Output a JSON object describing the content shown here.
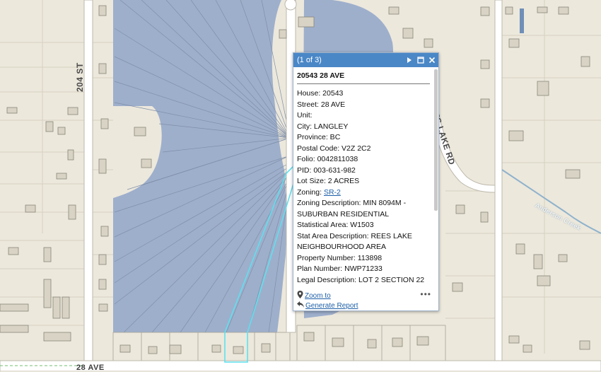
{
  "map": {
    "road_labels": {
      "st204": "204 ST",
      "rees_lake_rd": "REES LAKE RD",
      "anderson_creek": "Anderson Creek",
      "ave28": "28 AVE"
    }
  },
  "popup": {
    "counter": "(1 of 3)",
    "heading": "20543 28 AVE",
    "fields": {
      "house": "House: 20543",
      "street": "Street: 28 AVE",
      "unit": "Unit:",
      "city": "City: LANGLEY",
      "province": "Province: BC",
      "postal_code": "Postal Code: V2Z 2C2",
      "folio": "Folio: 0042811038",
      "pid": "PID: 003-631-982",
      "lot_size": "Lot Size: 2 ACRES",
      "zoning_label": "Zoning: ",
      "zoning_link": "SR-2",
      "zoning_description": "Zoning Description: MIN 8094M - SUBURBAN RESIDENTIAL",
      "statistical_area": "Statistical Area: W1503",
      "stat_area_description": "Stat Area Description: REES LAKE NEIGHBOURHOOD AREA",
      "property_number": "Property Number: 113898",
      "plan_number": "Plan Number: NWP71233",
      "legal_description": "Legal Description: LOT 2 SECTION 22"
    },
    "footer": {
      "zoom_to": "Zoom to",
      "generate_report": "Generate Report",
      "more": "•••"
    }
  },
  "colors": {
    "popup_title_bg": "#4a87c7",
    "selection_outline": "#5ee0ee",
    "parcel_fill": "#9eafcc",
    "map_background": "#ece8dc"
  }
}
